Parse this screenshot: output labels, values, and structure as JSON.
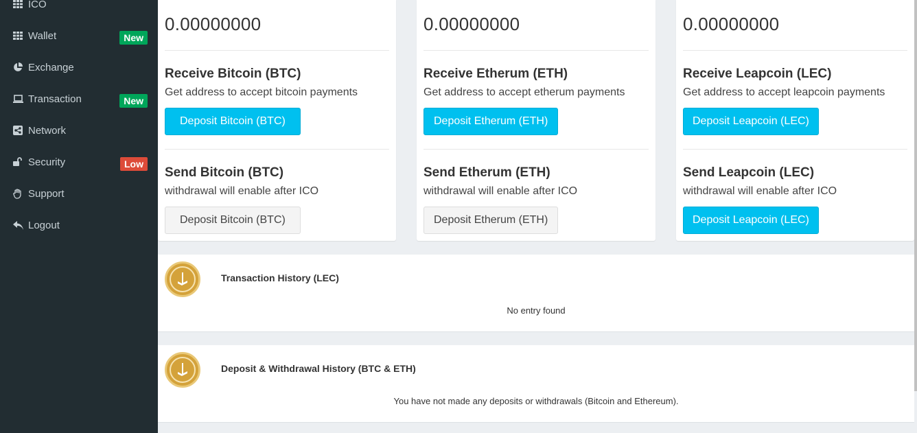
{
  "sidebar": {
    "items": [
      {
        "label": "ICO",
        "icon": "grid-icon"
      },
      {
        "label": "Wallet",
        "icon": "grid-icon",
        "badge": "New",
        "badge_color": "#00a65a"
      },
      {
        "label": "Exchange",
        "icon": "pie-chart-icon"
      },
      {
        "label": "Transaction",
        "icon": "laptop-icon",
        "badge": "New",
        "badge_color": "#00a65a"
      },
      {
        "label": "Network",
        "icon": "share-icon"
      },
      {
        "label": "Security",
        "icon": "unlock-icon",
        "badge": "Low",
        "badge_color": "#dd4b39"
      },
      {
        "label": "Support",
        "icon": "hand-icon"
      },
      {
        "label": "Logout",
        "icon": "reply-icon"
      }
    ]
  },
  "wallets": [
    {
      "balance": "0.00000000",
      "receive_title": "Receive Bitcoin (BTC)",
      "receive_sub": "Get address to accept bitcoin payments",
      "deposit_label": "Deposit Bitcoin (BTC)",
      "send_title": "Send Bitcoin (BTC)",
      "send_sub": "withdrawal will enable after ICO",
      "send_button_label": "Deposit Bitcoin (BTC)"
    },
    {
      "balance": "0.00000000",
      "receive_title": "Receive Etherum (ETH)",
      "receive_sub": "Get address to accept etherum payments",
      "deposit_label": "Deposit Etherum (ETH)",
      "send_title": "Send Etherum (ETH)",
      "send_sub": "withdrawal will enable after ICO",
      "send_button_label": "Deposit Etherum (ETH)"
    },
    {
      "balance": "0.00000000",
      "receive_title": "Receive Leapcoin (LEC)",
      "receive_sub": "Get address to accept leapcoin payments",
      "deposit_label": "Deposit Leapcoin (LEC)",
      "send_title": "Send Leapcoin (LEC)",
      "send_sub": "withdrawal will enable after ICO",
      "send_button_label": "Deposit Leapcoin (LEC)"
    }
  ],
  "transaction_history": {
    "title": "Transaction History (LEC)",
    "empty": "No entry found"
  },
  "deposit_history": {
    "title": "Deposit & Withdrawal History (BTC & ETH)",
    "empty": "You have not made any deposits or withdrawals (Bitcoin and Ethereum)."
  },
  "colors": {
    "sidebar_bg": "#222d32",
    "primary_button": "#00c0ef",
    "badge_green": "#00a65a",
    "badge_red": "#dd4b39",
    "coin_gold": "#d4a23a"
  }
}
